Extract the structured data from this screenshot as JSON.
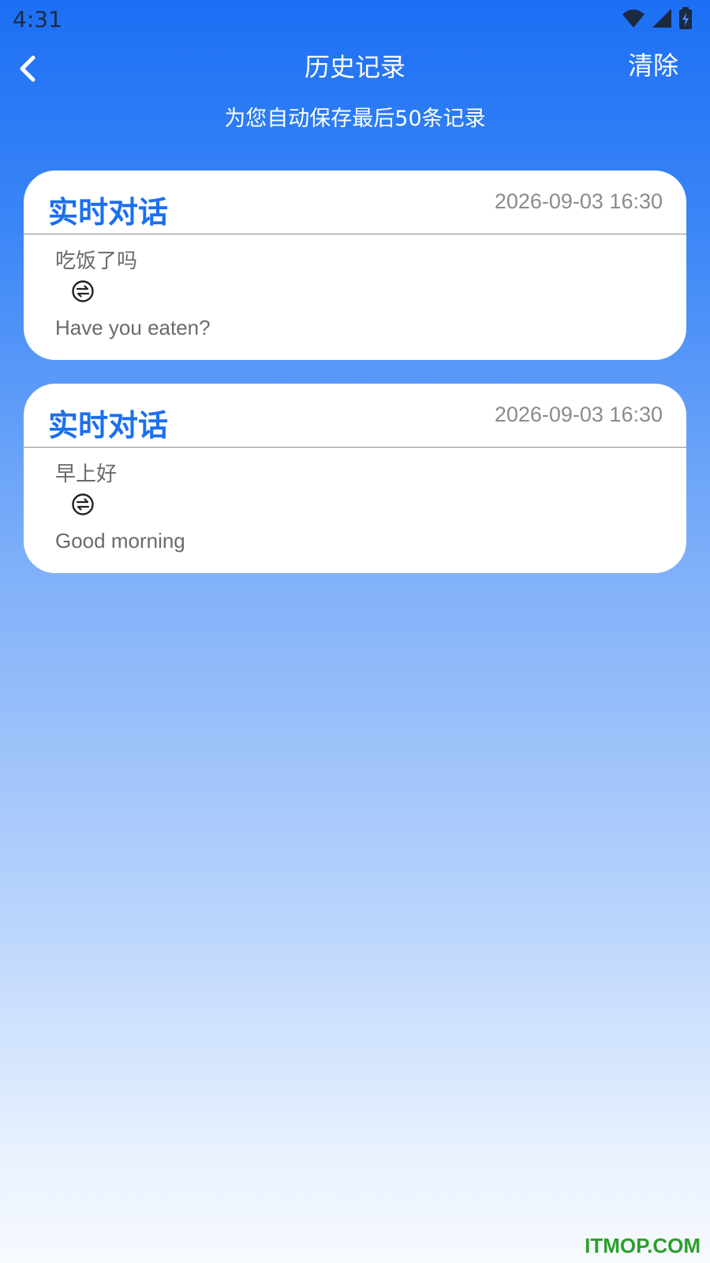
{
  "status_bar": {
    "time": "4:31",
    "icons": [
      "wifi-icon",
      "signal-icon",
      "battery-charging-icon"
    ]
  },
  "header": {
    "title": "历史记录",
    "clear_label": "清除",
    "back_icon": "chevron-left-icon"
  },
  "subtitle": "为您自动保存最后50条记录",
  "records": [
    {
      "type": "实时对话",
      "time": "2026-09-03 16:30",
      "source": "吃饭了吗",
      "target": "Have you eaten?"
    },
    {
      "type": "实时对话",
      "time": "2026-09-03 16:30",
      "source": "早上好",
      "target": "Good morning"
    }
  ],
  "colors": {
    "accent": "#1b6ff0",
    "header_bg": "#1c6ff5",
    "watermark": "#2aa02a"
  },
  "watermark": "ITMOP.COM"
}
